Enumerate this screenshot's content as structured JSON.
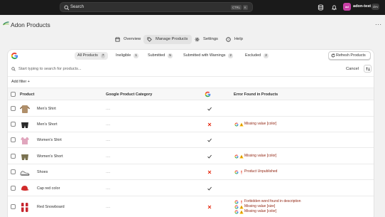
{
  "topbar": {
    "search_placeholder": "Search",
    "shortcut_keys": [
      "CTRL",
      "K"
    ],
    "avatar_initials": "ad",
    "store_name": "adon-test",
    "store_badge": "dev"
  },
  "app": {
    "title": "Adon Products",
    "more": "···"
  },
  "nav": {
    "tabs": [
      {
        "label": "Overview",
        "icon": "store-icon"
      },
      {
        "label": "Manage Products",
        "icon": "tag-icon",
        "active": true
      },
      {
        "label": "Settings",
        "icon": "gear-icon"
      },
      {
        "label": "Help",
        "icon": "help-icon"
      }
    ]
  },
  "filters": [
    {
      "label": "All Products",
      "count": "7",
      "active": true
    },
    {
      "label": "Ineligible",
      "count": "1"
    },
    {
      "label": "Submitted",
      "count": "5"
    },
    {
      "label": "Submitted with Warnings",
      "count": "2"
    },
    {
      "label": "Excluded",
      "count": "2"
    }
  ],
  "refresh_label": "Refresh Products",
  "product_search": {
    "placeholder": "Start typing to search for products...",
    "cancel_label": "Cancel"
  },
  "add_filter_label": "Add filter +",
  "columns": {
    "product": "Product",
    "category": "Google Product Category",
    "errors": "Error Found in Products"
  },
  "products": [
    {
      "name": "Men's Shirt",
      "category": "....",
      "status": "ok",
      "thumb": "mens-shirt",
      "errors": []
    },
    {
      "name": "Men's Short",
      "category": "....",
      "status": "fail",
      "thumb": "mens-short",
      "errors": [
        {
          "icon": "warning",
          "text": "Missing value [color]"
        }
      ]
    },
    {
      "name": "Women's Shirt",
      "category": "....",
      "status": "ok",
      "thumb": "womens-shirt",
      "errors": []
    },
    {
      "name": "Women's Short",
      "category": "....",
      "status": "ok",
      "thumb": "womens-short",
      "errors": [
        {
          "icon": "warning",
          "text": "Missing value [color]"
        }
      ]
    },
    {
      "name": "Shoes",
      "category": "....",
      "status": "fail",
      "thumb": "shoes",
      "errors": [
        {
          "icon": "error",
          "text": "Product Unpublished"
        }
      ]
    },
    {
      "name": "Cap red color",
      "category": "....",
      "status": "ok",
      "thumb": "cap",
      "errors": []
    },
    {
      "name": "Red Snowboard",
      "category": "....",
      "status": "fail",
      "thumb": "snowboard",
      "errors": [
        {
          "icon": "error",
          "text": "Forbidden word found in description"
        },
        {
          "icon": "warning",
          "text": "Missing value [size]"
        },
        {
          "icon": "warning",
          "text": "Missing value [color]"
        }
      ]
    }
  ],
  "colors": {
    "accent_green": "#29845a",
    "error_red": "#e51c00",
    "warning_orange": "#b98900",
    "error_text": "#8e1f0b"
  }
}
